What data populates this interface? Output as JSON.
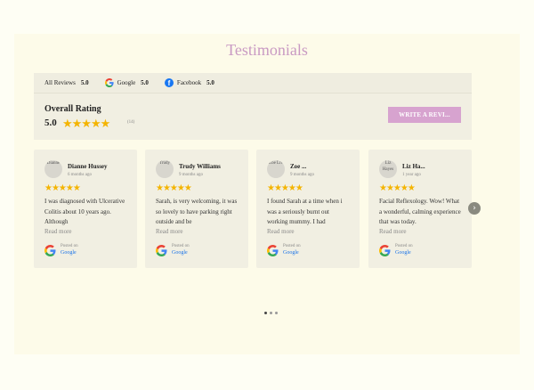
{
  "section": {
    "title": "Testimonials"
  },
  "tabs": [
    {
      "label": "All Reviews",
      "score": "5.0",
      "icon": "none"
    },
    {
      "label": "Google",
      "score": "5.0",
      "icon": "google-icon"
    },
    {
      "label": "Facebook",
      "score": "5.0",
      "icon": "facebook-icon"
    }
  ],
  "overall": {
    "label": "Overall Rating",
    "score": "5.0",
    "stars": "★★★★★",
    "count": "(14)",
    "write_button": "WRITE A REVI..."
  },
  "reviews": [
    {
      "avatar_alt": "Dianne",
      "name": "Dianne Hussey",
      "date": "6 months ago",
      "stars": "★★★★★",
      "text": "I was diagnosed with Ulcerative Colitis about 10 years ago. Although",
      "read_more": "Read more",
      "posted_on": "Posted on",
      "source": "Google"
    },
    {
      "avatar_alt": "Trudy",
      "name": "Trudy Williams",
      "date": "9 months ago",
      "stars": "★★★★★",
      "text": "Sarah, is very welcoming, it was so lovely to have parking right outside and be",
      "read_more": "Read more",
      "posted_on": "Posted on",
      "source": "Google"
    },
    {
      "avatar_alt": "Zoe Liv",
      "name": "Zoe ...",
      "date": "9 months ago",
      "stars": "★★★★★",
      "text": "I found Sarah at a time when i was a seriously burnt out working mummy. I had",
      "read_more": "Read more",
      "posted_on": "Posted on",
      "source": "Google"
    },
    {
      "avatar_alt": "Liz Hayes",
      "name": "Liz Ha...",
      "date": "1 year ago",
      "stars": "★★★★★",
      "text": "Facial Reflexology. Wow! What a wonderful, calming experience that was today.",
      "read_more": "Read more",
      "posted_on": "Posted on",
      "source": "Google"
    }
  ],
  "carousel": {
    "next_icon": "chevron-right-icon",
    "next_glyph": "›",
    "dots": 3,
    "active_dot": 0
  },
  "colors": {
    "accent": "#d7a3cf",
    "title": "#c99ac3",
    "star": "#f4b400",
    "card": "#f1efe2"
  }
}
